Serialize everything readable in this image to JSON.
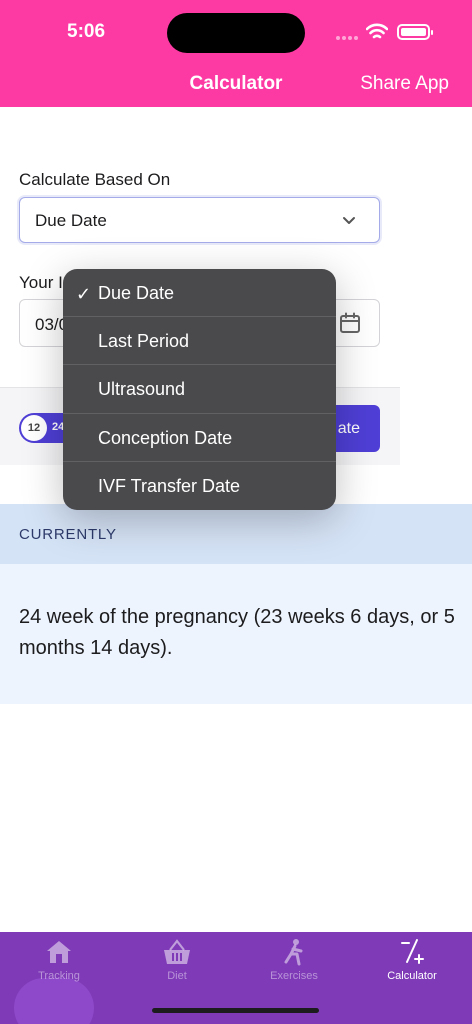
{
  "status": {
    "time": "5:06"
  },
  "header": {
    "title": "Calculator",
    "share_label": "Share App"
  },
  "form": {
    "calculate_label": "Calculate Based On",
    "calculate_value": "Due Date",
    "date_label_partial": "Your I",
    "date_value_partial": "03/0"
  },
  "toggle": {
    "knob_text": "12",
    "track_text": "24"
  },
  "calculate_button_partial": "ate",
  "currently": {
    "label": "CURRENTLY",
    "result": "24 week of the pregnancy (23 weeks 6 days, or 5 months 14 days)."
  },
  "dropdown": {
    "options": [
      "Due Date",
      "Last Period",
      "Ultrasound",
      "Conception Date",
      "IVF Transfer Date"
    ],
    "selected": "Due Date",
    "check_glyph": "✓"
  },
  "tabs": [
    {
      "label": "Tracking",
      "icon": "house-icon"
    },
    {
      "label": "Diet",
      "icon": "basket-icon"
    },
    {
      "label": "Exercises",
      "icon": "exercise-icon"
    },
    {
      "label": "Calculator",
      "icon": "calculator-icon"
    }
  ],
  "colors": {
    "header": "#fd3aa4",
    "accent": "#4f3fd6",
    "tabbar": "#7e3ab7"
  }
}
